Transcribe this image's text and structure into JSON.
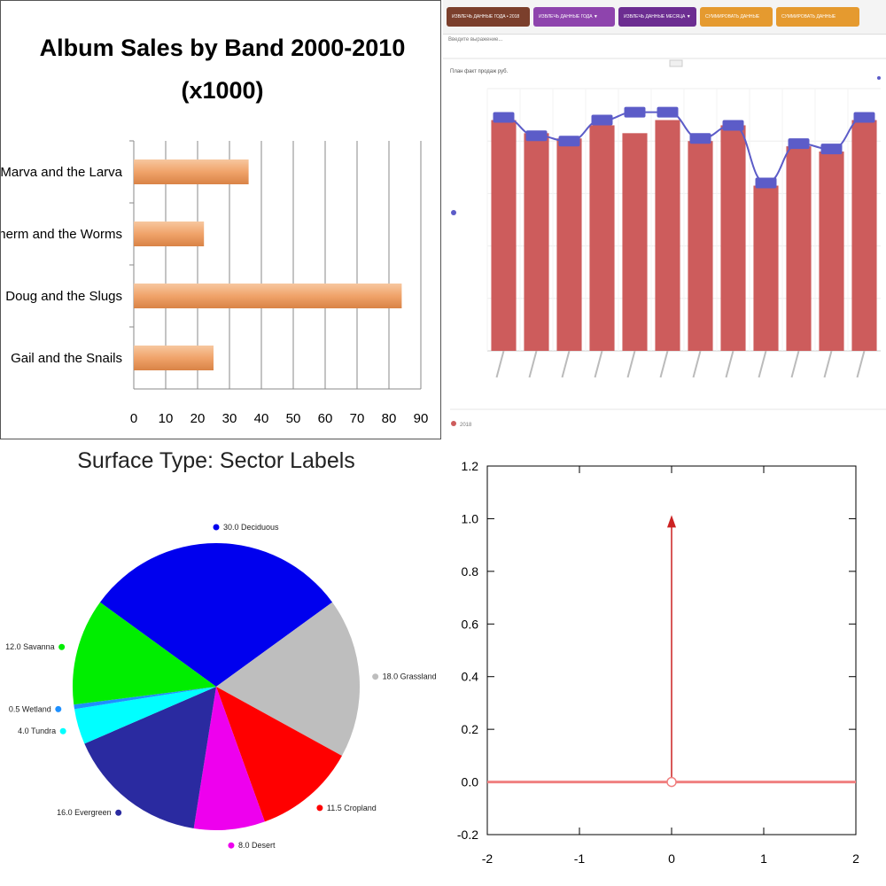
{
  "panels": {
    "album_sales": {
      "chart_data": {
        "type": "bar",
        "orientation": "horizontal",
        "title": "Album Sales by Band 2000-2010",
        "subtitle": "(x1000)",
        "categories": [
          "Marva and the Larva",
          "Sherm and the Worms",
          "Doug and the Slugs",
          "Gail and the Snails"
        ],
        "values": [
          36,
          22,
          84,
          25
        ],
        "xlim": [
          0,
          90
        ],
        "ticks": [
          "0",
          "10",
          "20",
          "30",
          "40",
          "50",
          "60",
          "70",
          "80",
          "90"
        ],
        "grid": "vertical",
        "bar_color": "#f0a36a"
      }
    },
    "dashboard": {
      "toolbar": {
        "tabs": [
          {
            "label": "ИЗВЛЕЧЬ ДАННЫЕ ГОДА • 2018",
            "color": "#7b3f2c"
          },
          {
            "label": "ИЗВЛЕЧЬ ДАННЫЕ ГОДА ▼",
            "color": "#8e44ad"
          },
          {
            "label": "ИЗВЛЕЧЬ ДАННЫЕ МЕСЯЦА ▼",
            "color": "#6c2d91"
          },
          {
            "label": "СУММИРОВАТЬ ДАННЫЕ",
            "color": "#e59a2f"
          },
          {
            "label": "СУММИРОВАТЬ ДАННЫЕ",
            "color": "#e59a2f"
          }
        ]
      },
      "filter_text": "Введите выражение...",
      "panel_title": "План факт продаж руб.",
      "chart_data": {
        "type": "bar",
        "series": [
          {
            "name": "2018",
            "kind": "bar",
            "color": "#cd5c5c",
            "values": [
              88,
              83,
              81,
              86,
              83,
              88,
              80,
              86,
              63,
              78,
              76,
              88
            ]
          },
          {
            "name": "",
            "kind": "line",
            "color": "#5c5cc8",
            "values": [
              89,
              82,
              80,
              88,
              91,
              91,
              81,
              86,
              64,
              79,
              77,
              89
            ]
          }
        ],
        "ylim": [
          0,
          100
        ],
        "legend": "bottom-left"
      }
    },
    "surface_pie": {
      "chart_data": {
        "type": "pie",
        "title": "Surface Type: Sector Labels",
        "slices": [
          {
            "label": "Deciduous",
            "value": 30.0,
            "value_text": "30.0",
            "color": "#0000ee"
          },
          {
            "label": "Grassland",
            "value": 18.0,
            "value_text": "18.0",
            "color": "#bebebe"
          },
          {
            "label": "Cropland",
            "value": 11.5,
            "value_text": "11.5",
            "color": "#ff0000"
          },
          {
            "label": "Desert",
            "value": 8.0,
            "value_text": "8.0",
            "color": "#ee00ee"
          },
          {
            "label": "Evergreen",
            "value": 16.0,
            "value_text": "16.0",
            "color": "#2a2aa0"
          },
          {
            "label": "Tundra",
            "value": 4.0,
            "value_text": "4.0",
            "color": "#00ffff"
          },
          {
            "label": "Wetland",
            "value": 0.5,
            "value_text": "0.5",
            "color": "#1e90ff"
          },
          {
            "label": "Savanna",
            "value": 12.0,
            "value_text": "12.0",
            "color": "#00ee00"
          }
        ]
      }
    },
    "impulse_plot": {
      "chart_data": {
        "type": "line",
        "xlim": [
          -2,
          2
        ],
        "ylim": [
          -0.2,
          1.2
        ],
        "xticks": [
          "-2",
          "-1",
          "0",
          "1",
          "2"
        ],
        "yticks": [
          "-0.2",
          "0.0",
          "0.2",
          "0.4",
          "0.6",
          "0.8",
          "1.0",
          "1.2"
        ],
        "series": [
          {
            "kind": "baseline",
            "y": 0.0,
            "color": "#f08080"
          },
          {
            "kind": "impulse",
            "x": 0,
            "y": 1.0,
            "color": "#cc2222"
          }
        ]
      }
    }
  }
}
